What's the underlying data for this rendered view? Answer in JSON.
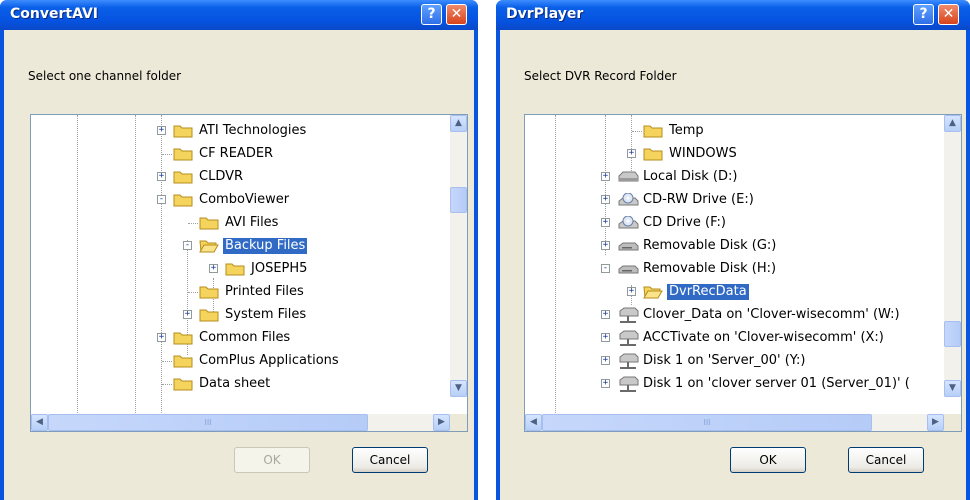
{
  "dialogs": [
    {
      "title": "ConvertAVI",
      "prompt": "Select one channel folder",
      "tree": [
        {
          "label": "ATI Technologies",
          "expander": "+",
          "icon": "folder"
        },
        {
          "label": "CF READER",
          "expander": "",
          "icon": "folder"
        },
        {
          "label": "CLDVR",
          "expander": "+",
          "icon": "folder"
        },
        {
          "label": "ComboViewer",
          "expander": "-",
          "icon": "folder"
        },
        {
          "label": "AVI Files",
          "expander": "",
          "icon": "folder"
        },
        {
          "label": "Backup Files",
          "expander": "-",
          "icon": "folder-open",
          "selected": true
        },
        {
          "label": "JOSEPH5",
          "expander": "+",
          "icon": "folder"
        },
        {
          "label": "Printed Files",
          "expander": "",
          "icon": "folder"
        },
        {
          "label": "System Files",
          "expander": "+",
          "icon": "folder"
        },
        {
          "label": "Common Files",
          "expander": "+",
          "icon": "folder"
        },
        {
          "label": "ComPlus Applications",
          "expander": "",
          "icon": "folder"
        },
        {
          "label": "Data sheet",
          "expander": "",
          "icon": "folder"
        }
      ],
      "ok_label": "OK",
      "cancel_label": "Cancel",
      "ok_enabled": false
    },
    {
      "title": "DvrPlayer",
      "prompt": "Select DVR Record Folder",
      "tree": [
        {
          "label": "Temp",
          "expander": "",
          "icon": "folder"
        },
        {
          "label": "WINDOWS",
          "expander": "+",
          "icon": "folder"
        },
        {
          "label": "Local Disk (D:)",
          "expander": "+",
          "icon": "hard-drive"
        },
        {
          "label": "CD-RW Drive (E:)",
          "expander": "+",
          "icon": "cd-drive"
        },
        {
          "label": "CD Drive (F:)",
          "expander": "+",
          "icon": "cd-drive"
        },
        {
          "label": "Removable Disk (G:)",
          "expander": "+",
          "icon": "removable-drive"
        },
        {
          "label": "Removable Disk (H:)",
          "expander": "-",
          "icon": "removable-drive"
        },
        {
          "label": "DvrRecData",
          "expander": "+",
          "icon": "folder-open",
          "selected": true
        },
        {
          "label": "Clover_Data on 'Clover-wisecomm' (W:)",
          "expander": "+",
          "icon": "network-drive"
        },
        {
          "label": "ACCTivate on 'Clover-wisecomm' (X:)",
          "expander": "+",
          "icon": "network-drive"
        },
        {
          "label": "Disk 1 on 'Server_00'  (Y:)",
          "expander": "+",
          "icon": "network-drive"
        },
        {
          "label": "Disk 1 on 'clover server 01 (Server_01)' (",
          "expander": "+",
          "icon": "network-drive"
        }
      ],
      "ok_label": "OK",
      "cancel_label": "Cancel",
      "ok_enabled": true
    }
  ],
  "icons": {
    "help": "?",
    "close": "✕",
    "scroll_up": "▲",
    "scroll_down": "▼",
    "scroll_left": "◀",
    "scroll_right": "▶",
    "thumb_grip": "III"
  },
  "colors": {
    "titlebar": "#0553e0",
    "dialog_face": "#ece9d8",
    "selection": "#316ac5",
    "folder": "#f5d45e"
  }
}
